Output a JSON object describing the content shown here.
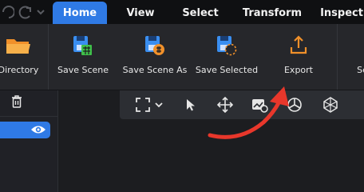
{
  "menu": {
    "tabs": [
      {
        "label": "Home",
        "active": true
      },
      {
        "label": "View",
        "active": false
      },
      {
        "label": "Select",
        "active": false
      },
      {
        "label": "Transform",
        "active": false
      },
      {
        "label": "Inspect",
        "active": false
      }
    ]
  },
  "ribbon": {
    "buttons": [
      {
        "label": "Directory",
        "icon": "folder-icon"
      },
      {
        "label": "Save Scene",
        "icon": "save-scene-icon"
      },
      {
        "label": "Save Scene As",
        "icon": "save-scene-as-icon"
      },
      {
        "label": "Save Selected",
        "icon": "save-selected-icon"
      },
      {
        "label": "Export",
        "icon": "export-icon"
      },
      {
        "label": "Se",
        "icon": "cut-off-icon"
      }
    ]
  },
  "left_panel": {
    "delete_icon": "trash-icon",
    "visibility_icon": "eye-icon"
  },
  "viewport_toolbar": {
    "icons": [
      "fit-view-icon",
      "chevron-down-icon",
      "select-pointer-icon",
      "move-icon",
      "screenshot-icon",
      "axes-icon",
      "mesh-icon"
    ]
  },
  "annotation": {
    "arrow_color": "#e8372b"
  },
  "colors": {
    "accent": "#2f7ae5",
    "save_icon_blue": "#3a8ef0",
    "save_icon_green": "#3fbf4a",
    "export_orange": "#f0902a"
  }
}
